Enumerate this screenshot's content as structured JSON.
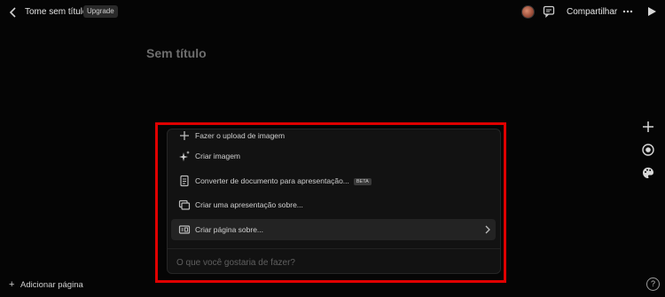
{
  "header": {
    "doc_title": "Tome sem título",
    "upgrade_badge": "Upgrade",
    "share_label": "Compartilhar",
    "icons": [
      "back-icon",
      "avatar",
      "comment-icon",
      "more-icon",
      "play-icon"
    ]
  },
  "page": {
    "title": "Sem título"
  },
  "menu": {
    "items": [
      {
        "label": "Fazer o upload de imagem",
        "icon": "upload-icon"
      },
      {
        "label": "Criar imagem",
        "icon": "sparkle-icon"
      },
      {
        "label": "Converter de documento para apresentação...",
        "badge": "BETA",
        "icon": "document-icon"
      },
      {
        "label": "Criar uma apresentação sobre...",
        "icon": "slides-icon"
      },
      {
        "label": "Criar página sobre...",
        "icon": "page-icon",
        "active": true
      }
    ],
    "prompt_placeholder": "O que você gostaria de fazer?"
  },
  "sidebar_right": {
    "icons": [
      "plus-icon",
      "record-icon",
      "palette-icon"
    ]
  },
  "footer": {
    "add_page_label": "Adicionar página",
    "help_label": "?"
  },
  "colors": {
    "background": "#050505",
    "panel": "#121212",
    "highlight": "#e00000"
  }
}
